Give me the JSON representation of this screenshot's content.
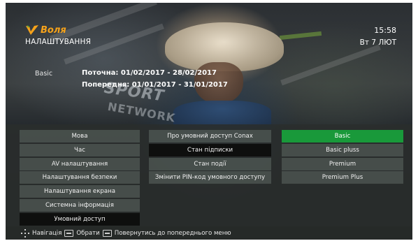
{
  "brand": {
    "logo_text": "Воля",
    "logo_color": "#f6a21a"
  },
  "header": {
    "title": "НАЛАШТУВАННЯ",
    "time": "15:58",
    "date": "Вт 7 ЛЮТ"
  },
  "subscription": {
    "package": "Basic",
    "current": "Поточна: 01/02/2017 - 28/02/2017",
    "previous": "Попередня: 01/01/2017 - 31/01/2017"
  },
  "menu": {
    "main_items": [
      "Мова",
      "Час",
      "AV налаштування",
      "Налаштування безпеки",
      "Налаштування екрана",
      "Системна інформація",
      "Умовний доступ"
    ],
    "sub_items": [
      "Про умовний доступ Conax",
      "Стан підписки",
      "Стан події",
      "Змінити PIN-код умовного доступу"
    ],
    "packages": [
      "Basic",
      "Basic pluss",
      "Premium",
      "Premium Plus"
    ],
    "selected_package": "Basic",
    "highlight_color": "#19993a"
  },
  "hints": {
    "navigate_icon": "dpad-icon",
    "navigate": "Навігація",
    "ok_icon": "ok-key-icon",
    "select": "Обрати",
    "back_icon": "back-key-icon",
    "back": "Повернутись до попереднього меню"
  },
  "background": {
    "sign_text_1": "SPORT",
    "sign_text_2": "NETWORK"
  }
}
